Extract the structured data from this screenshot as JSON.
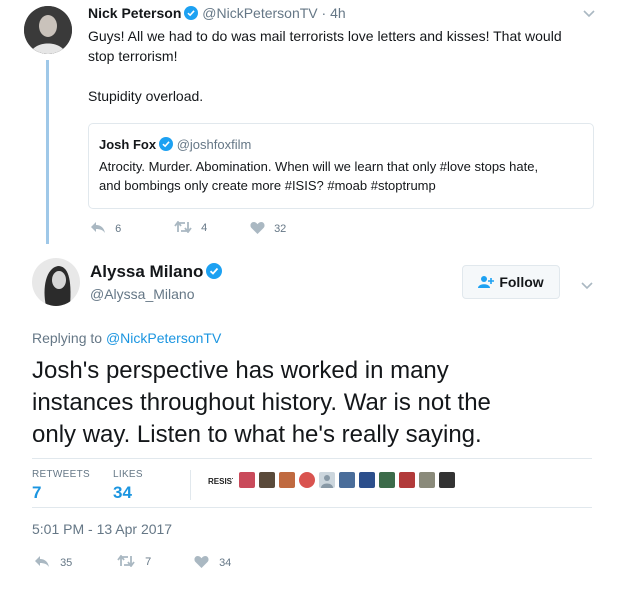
{
  "parent_tweet": {
    "author_name": "Nick Peterson",
    "handle": "@NickPetersonTV",
    "time": "· 4h",
    "text_line1": "Guys! All we had to do was mail terrorists love letters and kisses! That would",
    "text_line2": "stop terrorism!",
    "text_line3": "Stupidity overload.",
    "quote": {
      "author_name": "Josh Fox",
      "handle": "@joshfoxfilm",
      "text_line1": "Atrocity. Murder. Abomination. When will we learn that only #love stops hate,",
      "text_line2": "and bombings only create more #ISIS? #moab #stoptrump"
    },
    "actions": {
      "replies": "6",
      "retweets": "4",
      "likes": "32"
    }
  },
  "main_tweet": {
    "author_name": "Alyssa Milano",
    "handle": "@Alyssa_Milano",
    "follow_label": "Follow",
    "replying_prefix": "Replying to",
    "replying_handle": "@NickPetersonTV",
    "text_line1": "Josh's perspective has worked in many",
    "text_line2": "instances throughout history. War is not the",
    "text_line3": "only way. Listen to what he's really saying.",
    "stats": {
      "retweets_label": "RETWEETS",
      "retweets_value": "7",
      "likes_label": "LIKES",
      "likes_value": "34"
    },
    "liker_avatars": [
      "resist-avatar",
      "avatar-2",
      "avatar-3",
      "avatar-4",
      "avatar-5",
      "avatar-6",
      "avatar-7",
      "avatar-8",
      "avatar-9",
      "avatar-10"
    ],
    "resist_text": "RESIST",
    "timestamp": "5:01 PM - 13 Apr 2017",
    "actions": {
      "replies": "35",
      "retweets": "7",
      "likes": "34"
    }
  },
  "colors": {
    "link": "#1b95e0",
    "text": "#14171a",
    "gray": "#657786",
    "icon": "#aab8c2",
    "thread_line": "#9fc8e8"
  }
}
